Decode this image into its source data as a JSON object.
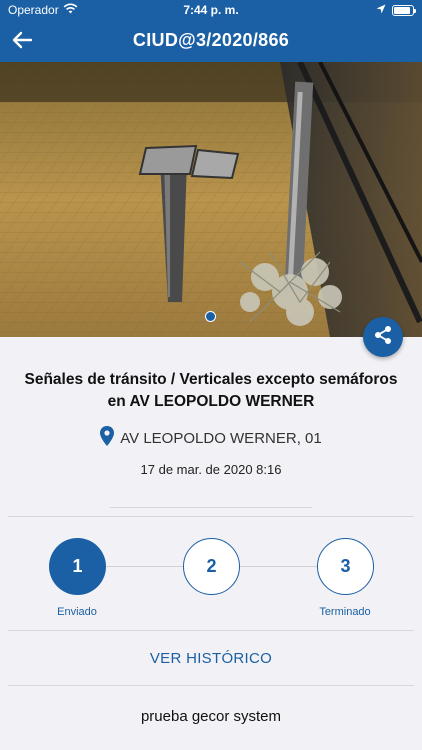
{
  "status_bar": {
    "carrier": "Operador",
    "time": "7:44 p. m.",
    "battery_level": 0.9
  },
  "header": {
    "title": "CIUD@3/2020/866",
    "back_icon": "arrow-left-icon"
  },
  "photo": {
    "page_indicator_icon": "page-dot-icon",
    "share_icon": "share-icon"
  },
  "incident": {
    "title": "Señales de tránsito / Verticales excepto semáforos en AV LEOPOLDO WERNER",
    "address_icon": "location-pin-icon",
    "address": "AV LEOPOLDO WERNER, 01",
    "date": "17 de mar. de 2020 8:16"
  },
  "steps": [
    {
      "number": "1",
      "label": "Enviado",
      "active": true
    },
    {
      "number": "2",
      "label": "",
      "active": false
    },
    {
      "number": "3",
      "label": "Terminado",
      "active": false
    }
  ],
  "history_link": "VER HISTÓRICO",
  "footer": "prueba gecor system",
  "colors": {
    "primary": "#1b5fa4",
    "background": "#f2f2f6"
  }
}
